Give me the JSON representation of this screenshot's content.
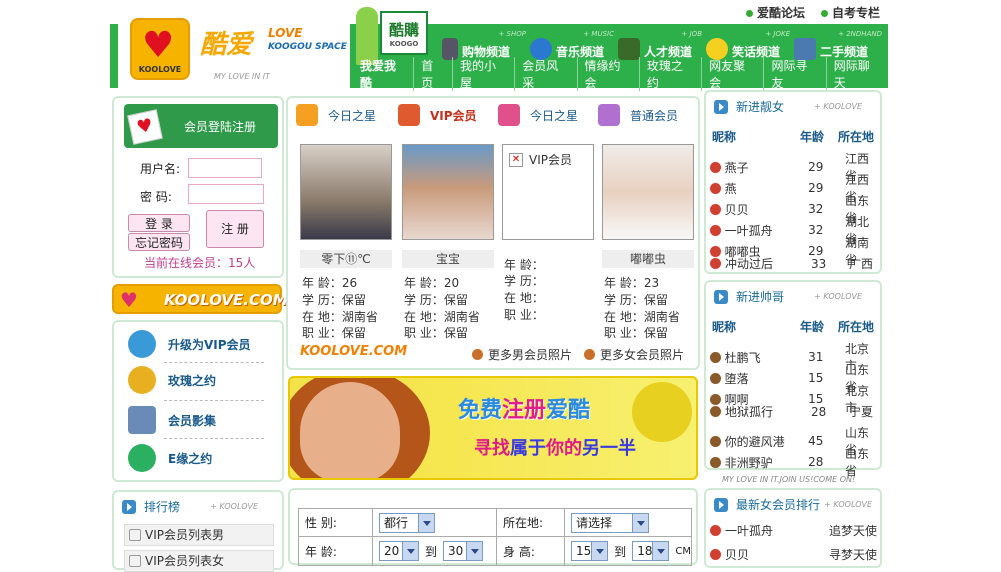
{
  "header": {
    "top_links": [
      "爱酷论坛",
      "自考专栏"
    ],
    "logo_cn": "酷爱",
    "logo_en1": "LOVE",
    "logo_en2": "KOOGOU SPACE",
    "logo_badge": "KOOLOVE",
    "logo_slogan": "MY LOVE IN IT",
    "buy_title": "酷購",
    "buy_sub": "KOOGO",
    "channels": [
      {
        "label": "购物频道",
        "en": "+ SHOP",
        "icon": "phone-icon"
      },
      {
        "label": "音乐频道",
        "en": "+ MUSIC",
        "icon": "music-icon"
      },
      {
        "label": "人才频道",
        "en": "+ JOB",
        "icon": "people-icon"
      },
      {
        "label": "笑话频道",
        "en": "+ JOKE",
        "icon": "smile-icon"
      },
      {
        "label": "二手频道",
        "en": "+ 2NDHAND",
        "icon": "monitor-icon"
      }
    ],
    "nav_first": "我爱我酷",
    "nav": [
      "首页",
      "我的小屋",
      "会员风采",
      "情缘约会",
      "玫瑰之约",
      "网友聚会",
      "网际寻友",
      "网际聊天"
    ]
  },
  "login": {
    "title": "会员登陆注册",
    "user_label": "用户名:",
    "pass_label": "密  码:",
    "login_btn": "登 录",
    "forgot_btn": "忘记密码",
    "register_btn": "注 册",
    "online_text": "当前在线会员：15人"
  },
  "koolove_banner": "KOOLOVE.COM",
  "left_menu": [
    {
      "label": "升级为VIP会员",
      "color": "#3a9ad8"
    },
    {
      "label": "玫瑰之约",
      "color": "#e8b020"
    },
    {
      "label": "会员影集",
      "color": "#6a8ab8"
    },
    {
      "label": "E缘之约",
      "color": "#2ab060"
    }
  ],
  "ranking": {
    "title": "排行榜",
    "tag": "+ KOOLOVE",
    "items": [
      "VIP会员列表男",
      "VIP会员列表女"
    ]
  },
  "members": [
    {
      "head": "今日之星",
      "color": "#f5a020",
      "name": "零下⑪℃",
      "age": "年 龄：26",
      "edu": "学 历：保留",
      "loc": "在 地：湖南省",
      "job": "职 业：保留",
      "photo": "#8a7a6a"
    },
    {
      "head": "VIP会员",
      "color": "#e05a30",
      "name": "宝宝",
      "age": "年 龄：20",
      "edu": "学 历：保留",
      "loc": "在 地：湖南省",
      "job": "职 业：保留",
      "photo": "#c89a7a"
    },
    {
      "head": "今日之星",
      "color": "#e0508a",
      "name": "",
      "age": "年 龄：",
      "edu": "学 历：",
      "loc": "在 地：",
      "job": "职 业：",
      "photo": ""
    },
    {
      "head": "普通会员",
      "color": "#b070d0",
      "name": "嘟嘟虫",
      "age": "年 龄：23",
      "edu": "学 历：保留",
      "loc": "在 地：湖南省",
      "job": "职 业：保留",
      "photo": "#e8d0c0"
    }
  ],
  "vip_placeholder": "VIP会员",
  "members_footer": {
    "logo": "KOOLOVE.COM",
    "more_male": "更多男会员照片",
    "more_female": "更多女会员照片"
  },
  "ad": {
    "line1_a": "免费",
    "line1_b": "注册",
    "line1_c": "爱酷",
    "line2_a": "寻找",
    "line2_b": "属于",
    "line2_c": "你的",
    "line2_d": "另一半"
  },
  "search": {
    "gender_label": "性  别:",
    "gender_value": "都行",
    "loc_label": "所在地:",
    "loc_value": "请选择",
    "age_label": "年  龄:",
    "age_from": "20",
    "to1": "到",
    "age_to": "30",
    "height_label": "身  高:",
    "height_from": "15",
    "to2": "到",
    "height_to": "18",
    "unit": "CM"
  },
  "new_girls": {
    "title": "新进靓女",
    "tag": "+ KOOLOVE",
    "cols": [
      "昵称",
      "年龄",
      "所在地"
    ],
    "rows": [
      [
        "燕子",
        "29",
        "江西省"
      ],
      [
        "燕",
        "29",
        "江西省"
      ],
      [
        "贝贝",
        "32",
        "山东省"
      ],
      [
        "一叶孤舟",
        "32",
        "湖北省"
      ],
      [
        "嘟嘟虫",
        "29",
        "湖南省"
      ],
      [
        "冲动过后",
        "33",
        "广西"
      ]
    ]
  },
  "new_guys": {
    "title": "新进帅哥",
    "tag": "+ KOOLOVE",
    "cols": [
      "昵称",
      "年龄",
      "所在地"
    ],
    "rows": [
      [
        "杜鹏飞",
        "31",
        "北京市"
      ],
      [
        "堕落",
        "15",
        "山东省"
      ],
      [
        "啊啊",
        "15",
        "北京市"
      ],
      [
        "地狱孤行",
        "28",
        "宁夏"
      ],
      [
        "你的避风港",
        "45",
        "山东省"
      ],
      [
        "非洲野驴",
        "28",
        "山东省"
      ]
    ]
  },
  "right_slogan": "MY LOVE IN IT.JOIN US!COME ON!",
  "female_rank": {
    "title": "最新女会员排行",
    "tag": "+ KOOLOVE",
    "rows": [
      [
        "一叶孤舟",
        "追梦天使"
      ],
      [
        "贝贝",
        "寻梦天使"
      ]
    ]
  }
}
